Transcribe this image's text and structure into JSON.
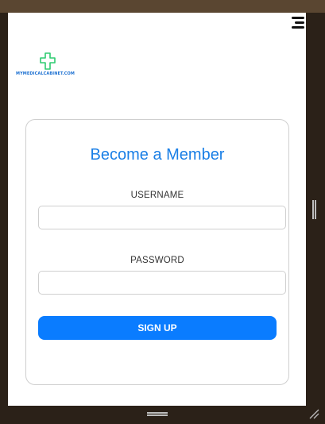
{
  "header": {
    "menu_icon": "hamburger-menu-icon",
    "logo_icon": "medical-cross-icon",
    "logo_text": "MYMEDICALCABINET.COM"
  },
  "signup_card": {
    "title": "Become a Member",
    "username_label": "USERNAME",
    "username_value": "",
    "password_label": "PASSWORD",
    "password_value": "",
    "submit_label": "SIGN UP"
  },
  "colors": {
    "accent": "#1a7fe6",
    "button": "#0a7cff",
    "logo_green": "#2ecc71",
    "frame": "#2b2118"
  }
}
